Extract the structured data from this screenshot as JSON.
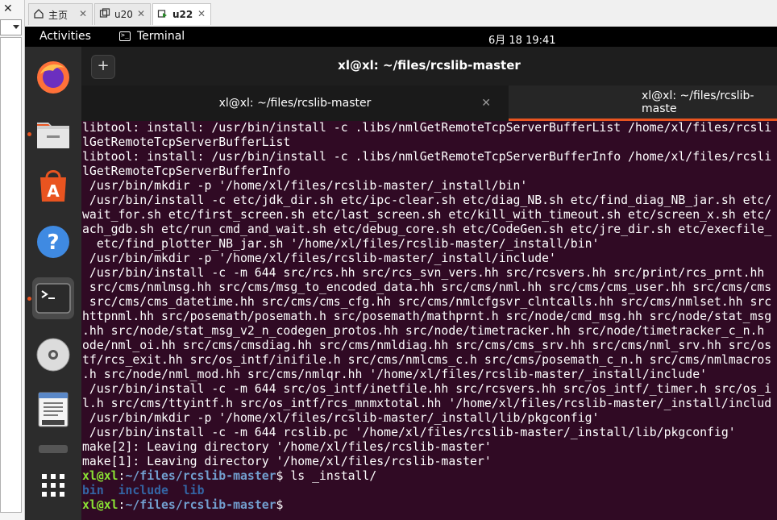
{
  "vm_tabs": [
    {
      "label": "主页"
    },
    {
      "label": "u20"
    },
    {
      "label": "u22"
    }
  ],
  "host": {
    "close_glyph": "✕"
  },
  "topbar": {
    "activities": "Activities",
    "app_name": "Terminal",
    "clock": "6月 18  19:41"
  },
  "dock": {
    "items": [
      "firefox-icon",
      "files-icon",
      "software-icon",
      "help-icon",
      "terminal-icon",
      "disc-icon",
      "text-editor-icon",
      "drive-icon",
      "app-grid-icon"
    ]
  },
  "terminal": {
    "window_title": "xl@xl: ~/files/rcslib-master",
    "new_tab_glyph": "+",
    "tabs": [
      {
        "label": "xl@xl: ~/files/rcslib-master",
        "close": "✕"
      },
      {
        "label": "xl@xl: ~/files/rcslib-maste"
      }
    ],
    "lines": [
      "libtool: install: /usr/bin/install -c .libs/nmlGetRemoteTcpServerBufferList /home/xl/files/rcsli",
      "lGetRemoteTcpServerBufferList",
      "libtool: install: /usr/bin/install -c .libs/nmlGetRemoteTcpServerBufferInfo /home/xl/files/rcsli",
      "lGetRemoteTcpServerBufferInfo",
      " /usr/bin/mkdir -p '/home/xl/files/rcslib-master/_install/bin'",
      " /usr/bin/install -c etc/jdk_dir.sh etc/ipc-clear.sh etc/diag_NB.sh etc/find_diag_NB_jar.sh etc/",
      "wait_for.sh etc/first_screen.sh etc/last_screen.sh etc/kill_with_timeout.sh etc/screen_x.sh etc/",
      "ach_gdb.sh etc/run_cmd_and_wait.sh etc/debug_core.sh etc/CodeGen.sh etc/jre_dir.sh etc/execfile_",
      "  etc/find_plotter_NB_jar.sh '/home/xl/files/rcslib-master/_install/bin'",
      " /usr/bin/mkdir -p '/home/xl/files/rcslib-master/_install/include'",
      " /usr/bin/install -c -m 644 src/rcs.hh src/rcs_svn_vers.hh src/rcsvers.hh src/print/rcs_prnt.hh",
      " src/cms/nmlmsg.hh src/cms/msg_to_encoded_data.hh src/cms/nml.hh src/cms/cms_user.hh src/cms/cms",
      " src/cms/cms_datetime.hh src/cms/cms_cfg.hh src/cms/nmlcfgsvr_clntcalls.hh src/cms/nmlset.hh src",
      "httpnml.hh src/posemath/posemath.h src/posemath/mathprnt.h src/node/cmd_msg.hh src/node/stat_msg",
      ".hh src/node/stat_msg_v2_n_codegen_protos.hh src/node/timetracker.hh src/node/timetracker_c_n.h",
      "ode/nml_oi.hh src/cms/cmsdiag.hh src/cms/nmldiag.hh src/cms/cms_srv.hh src/cms/nml_srv.hh src/os",
      "tf/rcs_exit.hh src/os_intf/inifile.h src/cms/nmlcms_c.h src/cms/posemath_c_n.h src/cms/nmlmacros",
      ".h src/node/nml_mod.hh src/cms/nmlqr.hh '/home/xl/files/rcslib-master/_install/include'",
      " /usr/bin/install -c -m 644 src/os_intf/inetfile.hh src/rcsvers.hh src/os_intf/_timer.h src/os_i",
      "l.h src/cms/ttyintf.h src/os_intf/rcs_mnmxtotal.hh '/home/xl/files/rcslib-master/_install/includ",
      " /usr/bin/mkdir -p '/home/xl/files/rcslib-master/_install/lib/pkgconfig'",
      " /usr/bin/install -c -m 644 rcslib.pc '/home/xl/files/rcslib-master/_install/lib/pkgconfig'",
      "make[2]: Leaving directory '/home/xl/files/rcslib-master'",
      "make[1]: Leaving directory '/home/xl/files/rcslib-master'"
    ],
    "prompt_user": "xl@xl",
    "prompt_colon": ":",
    "prompt_path": "~/files/rcslib-master",
    "prompt_dollar": "$",
    "command": " ls _install/",
    "ls_output": [
      "bin",
      "include",
      "lib"
    ],
    "colors": {
      "background": "#300a24",
      "prompt_user": "#8ae234",
      "prompt_path": "#729fcf",
      "dir": "#3465a4",
      "accent": "#e95420"
    }
  }
}
